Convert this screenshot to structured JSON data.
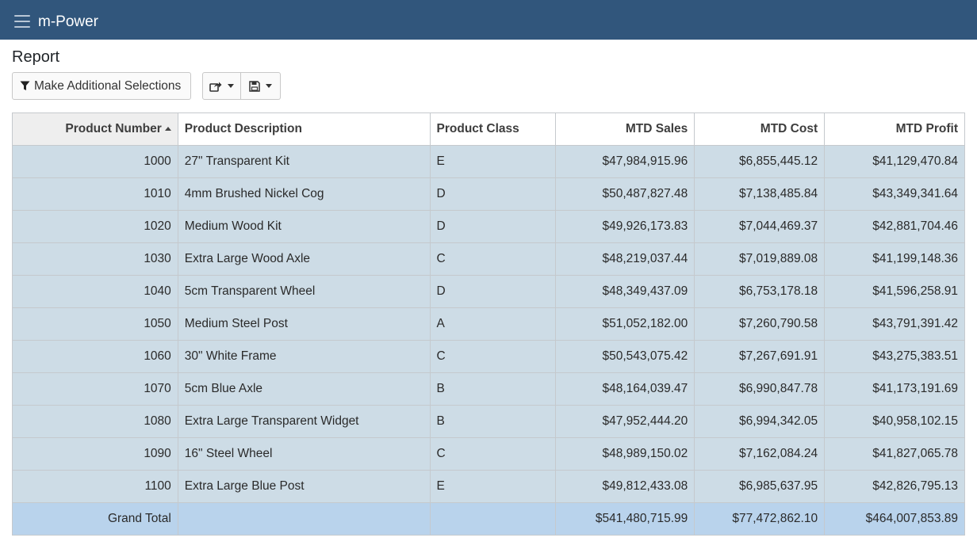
{
  "app": {
    "brand": "m-Power"
  },
  "page": {
    "title": "Report"
  },
  "toolbar": {
    "filter_label": "Make Additional Selections"
  },
  "colors": {
    "navbar": "#31567c",
    "row_bg": "#cddce6",
    "total_bg": "#b9d3ec"
  },
  "table": {
    "columns": [
      "Product Number",
      "Product Description",
      "Product Class",
      "MTD Sales",
      "MTD Cost",
      "MTD Profit"
    ],
    "rows": [
      [
        "1000",
        "27\" Transparent Kit",
        "E",
        "$47,984,915.96",
        "$6,855,445.12",
        "$41,129,470.84"
      ],
      [
        "1010",
        "4mm Brushed Nickel Cog",
        "D",
        "$50,487,827.48",
        "$7,138,485.84",
        "$43,349,341.64"
      ],
      [
        "1020",
        "Medium Wood Kit",
        "D",
        "$49,926,173.83",
        "$7,044,469.37",
        "$42,881,704.46"
      ],
      [
        "1030",
        "Extra Large Wood Axle",
        "C",
        "$48,219,037.44",
        "$7,019,889.08",
        "$41,199,148.36"
      ],
      [
        "1040",
        "5cm Transparent Wheel",
        "D",
        "$48,349,437.09",
        "$6,753,178.18",
        "$41,596,258.91"
      ],
      [
        "1050",
        "Medium Steel Post",
        "A",
        "$51,052,182.00",
        "$7,260,790.58",
        "$43,791,391.42"
      ],
      [
        "1060",
        "30\" White Frame",
        "C",
        "$50,543,075.42",
        "$7,267,691.91",
        "$43,275,383.51"
      ],
      [
        "1070",
        "5cm Blue Axle",
        "B",
        "$48,164,039.47",
        "$6,990,847.78",
        "$41,173,191.69"
      ],
      [
        "1080",
        "Extra Large Transparent Widget",
        "B",
        "$47,952,444.20",
        "$6,994,342.05",
        "$40,958,102.15"
      ],
      [
        "1090",
        "16\" Steel Wheel",
        "C",
        "$48,989,150.02",
        "$7,162,084.24",
        "$41,827,065.78"
      ],
      [
        "1100",
        "Extra Large Blue Post",
        "E",
        "$49,812,433.08",
        "$6,985,637.95",
        "$42,826,795.13"
      ]
    ],
    "total": {
      "label": "Grand Total",
      "sales": "$541,480,715.99",
      "cost": "$77,472,862.10",
      "profit": "$464,007,853.89"
    }
  }
}
